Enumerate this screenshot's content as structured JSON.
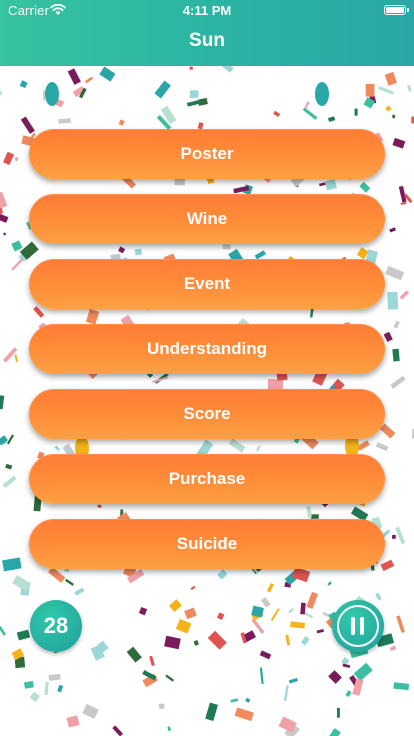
{
  "status_bar": {
    "carrier": "Carrier",
    "time": "4:11 PM"
  },
  "header": {
    "title": "Sun"
  },
  "options": [
    {
      "label": "Poster"
    },
    {
      "label": "Wine"
    },
    {
      "label": "Event"
    },
    {
      "label": "Understanding"
    },
    {
      "label": "Score"
    },
    {
      "label": "Purchase"
    },
    {
      "label": "Suicide"
    }
  ],
  "score": {
    "value": "28"
  },
  "controls": {
    "pause_icon": "pause-icon"
  },
  "colors": {
    "header": "#2bb3a3",
    "button_top": "#ff7c35",
    "button_bottom": "#fca043",
    "badge": "#26b0a2"
  }
}
